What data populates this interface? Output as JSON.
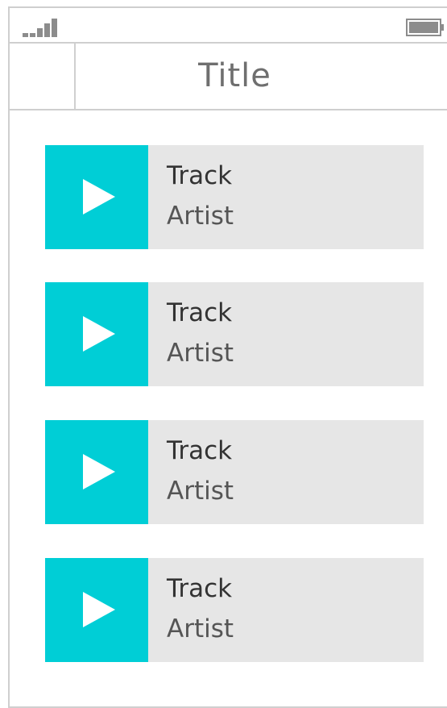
{
  "status_bar": {
    "signal_icon": "signal-strength-icon",
    "battery_icon": "battery-icon"
  },
  "nav": {
    "title": "Title"
  },
  "tracks": [
    {
      "track": "Track",
      "artist": "Artist",
      "icon": "play-icon"
    },
    {
      "track": "Track",
      "artist": "Artist",
      "icon": "play-icon"
    },
    {
      "track": "Track",
      "artist": "Artist",
      "icon": "play-icon"
    },
    {
      "track": "Track",
      "artist": "Artist",
      "icon": "play-icon"
    }
  ],
  "colors": {
    "accent": "#00ced6",
    "card_background": "#e6e6e6",
    "border": "#cfcfcf",
    "title_text": "#6f6f6f"
  }
}
